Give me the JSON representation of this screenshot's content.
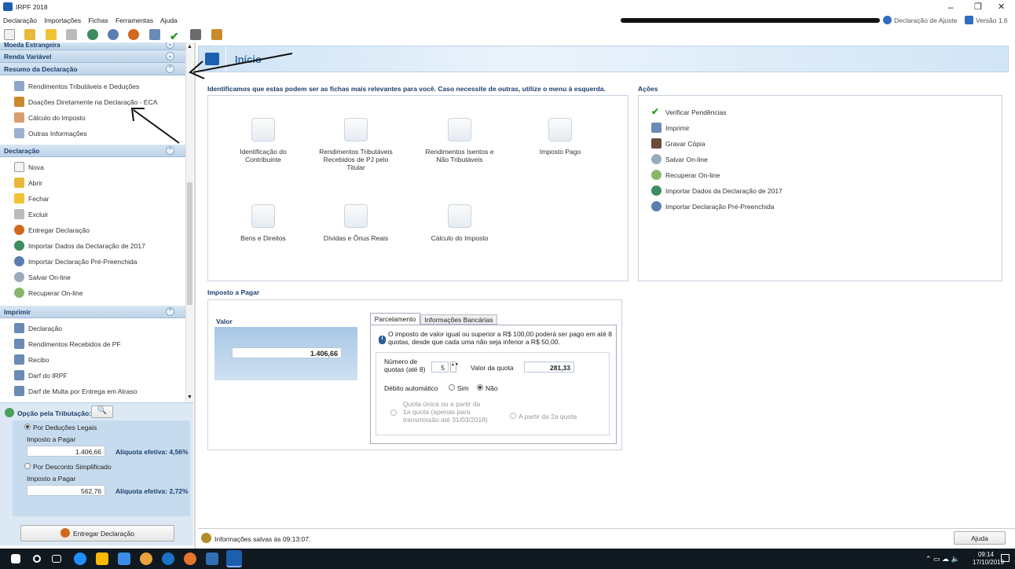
{
  "window": {
    "title": "IRPF 2018",
    "declaracao_ajuste": "Declaração de Ajuste",
    "versao": "Versão 1.6",
    "min": "–",
    "max": "❐",
    "close": "✕"
  },
  "menu": [
    "Declaração",
    "Importações",
    "Fichas",
    "Ferramentas",
    "Ajuda"
  ],
  "sidebar": {
    "sections": [
      {
        "label": "Moeda Estrangeira",
        "items": []
      },
      {
        "label": "Renda Variável",
        "items": []
      },
      {
        "label": "Resumo da Declaração",
        "items": [
          "Rendimentos Tributáveis e Deduções",
          "Doações Diretamente na Declaração - ECA",
          "Cálculo do Imposto",
          "Outras Informações"
        ]
      },
      {
        "label": "Declaração",
        "items": [
          "Nova",
          "Abrir",
          "Fechar",
          "Excluir",
          "Entregar Declaração",
          "Importar Dados da Declaração de 2017",
          "Importar Declaração Pré-Preenchida",
          "Salvar On-line",
          "Recuperar On-line"
        ]
      },
      {
        "label": "Imprimir",
        "items": [
          "Declaração",
          "Rendimentos Recebidos de PF",
          "Recibo",
          "Darf do IRPF",
          "Darf de Multa por Entrega em Atraso"
        ]
      }
    ]
  },
  "opcao": {
    "title": "Opção pela Tributação:",
    "legais": "Por Deduções Legais",
    "legais_label": "Imposto a Pagar",
    "legais_valor": "1.406,66",
    "legais_aliquota": "Alíquota efetiva: 4,56%",
    "simpl": "Por Desconto Simplificado",
    "simpl_label": "Imposto a Pagar",
    "simpl_valor": "562,76",
    "simpl_aliquota": "Alíquota efetiva: 2,72%",
    "entregar": "Entregar Declaração"
  },
  "main": {
    "banner": "Início",
    "intro": "Identificamos que estas podem ser as fichas mais relevantes para você. Caso necessite de outras, utilize o menu à esquerda.",
    "fichas": [
      "Identificação do Contribuinte",
      "Rendimentos Tributáveis Recebidos de PJ pelo Titular",
      "Rendimentos Isentos e Não Tributáveis",
      "Imposto Pago",
      "Bens e Direitos",
      "Dívidas e Ônus Reais",
      "Cálculo do Imposto"
    ],
    "acoes_title": "Ações",
    "acoes": [
      "Verificar Pendências",
      "Imprimir",
      "Gravar Cópia",
      "Salvar On-line",
      "Recuperar On-line",
      "Importar Dados da Declaração de 2017",
      "Importar Declaração Pré-Preenchida"
    ],
    "imposto_title": "Imposto a Pagar",
    "valor_label": "Valor",
    "valor": "1.406,66",
    "tab1": "Parcelamento",
    "tab2": "Informações Bancárias",
    "info": "O imposto de valor igual ou superior a R$ 100,00 poderá ser pago em até 8 quotas, desde que cada uma não seja inferior a R$ 50,00.",
    "num_quotas_label": "Número de quotas (até 8)",
    "num_quotas": "5",
    "valor_quota_label": "Valor da quota",
    "valor_quota": "281,33",
    "debito_label": "Débito automático",
    "sim": "Sim",
    "nao": "Não",
    "quota_unica": "Quota única ou a partir da 1a quota (apenas para transmissão até 31/03/2018)",
    "a_partir_2": "A partir da 2a quota",
    "status": "Informações salvas às 09:13:07.",
    "ajuda": "Ajuda"
  },
  "taskbar": {
    "time": "09:14",
    "date": "17/10/2019"
  }
}
